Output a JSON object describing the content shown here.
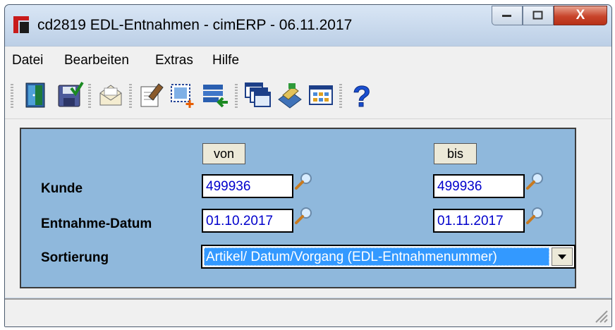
{
  "window": {
    "title": "cd2819 EDL-Entnahmen - cimERP - 06.11.2017"
  },
  "caption_buttons": {
    "close_label": "X"
  },
  "menu": {
    "items": [
      "Datei",
      "Bearbeiten",
      "Extras",
      "Hilfe"
    ]
  },
  "toolbar": {
    "buttons": [
      "exit-door-icon",
      "save-icon",
      "mail-icon",
      "edit-document-icon",
      "new-record-icon",
      "import-list-icon",
      "windows-icon",
      "book-icon",
      "grid-view-icon",
      "help-icon"
    ]
  },
  "form": {
    "von_label": "von",
    "bis_label": "bis",
    "kunde": {
      "label": "Kunde",
      "von": "499936",
      "bis": "499936"
    },
    "entnahme_datum": {
      "label": "Entnahme-Datum",
      "von": "01.10.2017",
      "bis": "01.11.2017"
    },
    "sortierung": {
      "label": "Sortierung",
      "selected": "Artikel/ Datum/Vorgang (EDL-Entnahmenummer)"
    }
  },
  "colors": {
    "panel_bg": "#8fb8dc",
    "field_text": "#0000cc",
    "selection": "#3399ff"
  }
}
